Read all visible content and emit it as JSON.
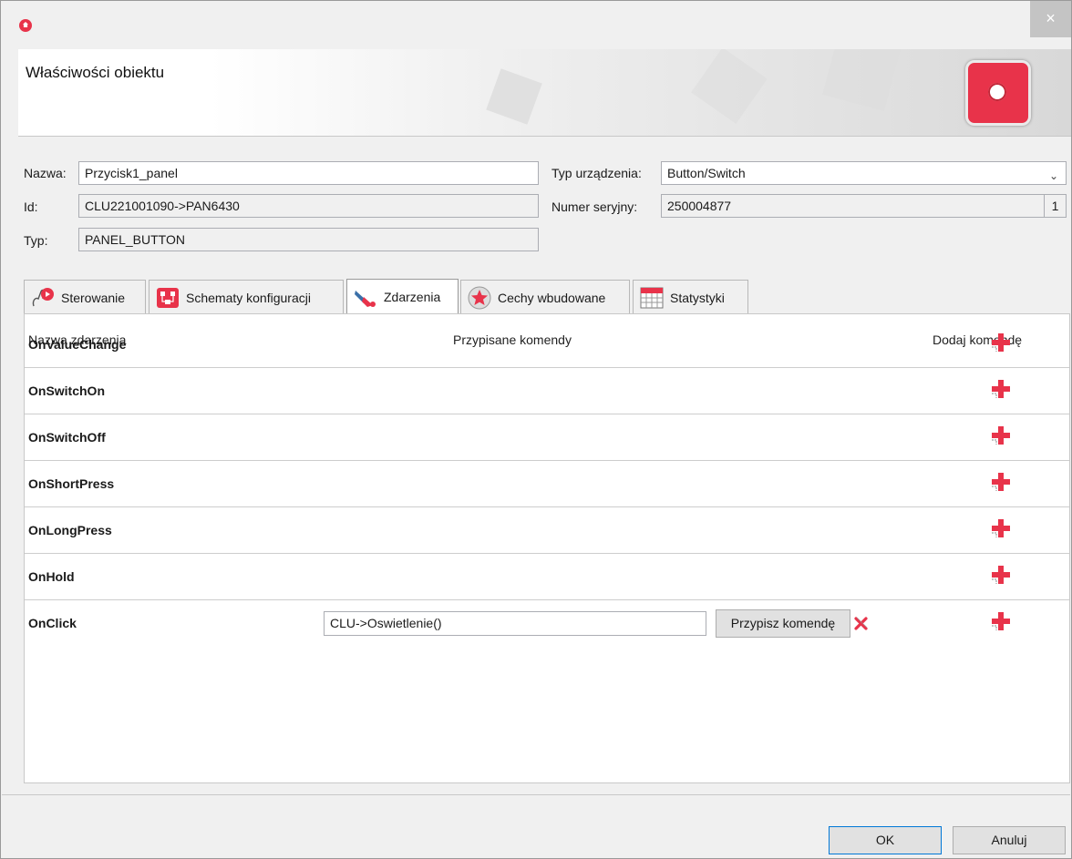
{
  "window": {
    "close_label": "×"
  },
  "header": {
    "title": "Właściwości obiektu"
  },
  "properties": {
    "name_label": "Nazwa:",
    "name_value": "Przycisk1_panel",
    "id_label": "Id:",
    "id_value": "CLU221001090->PAN6430",
    "type_label": "Typ:",
    "type_value": "PANEL_BUTTON",
    "device_type_label": "Typ urządzenia:",
    "device_type_value": "Button/Switch",
    "serial_label": "Numer seryjny:",
    "serial_value": "250004877",
    "serial_suffix": "1"
  },
  "tabs": [
    {
      "label": "Sterowanie",
      "icon": "hand-pointer-icon"
    },
    {
      "label": "Schematy konfiguracji",
      "icon": "schema-icon"
    },
    {
      "label": "Zdarzenia",
      "icon": "events-icon"
    },
    {
      "label": "Cechy wbudowane",
      "icon": "star-icon"
    },
    {
      "label": "Statystyki",
      "icon": "calendar-grid-icon"
    }
  ],
  "active_tab": "Zdarzenia",
  "events": {
    "col_name": "Nazwa zdarzenia",
    "col_commands": "Przypisane komendy",
    "col_add": "Dodaj komendę",
    "rows": [
      {
        "name": "OnValueChange"
      },
      {
        "name": "OnSwitchOn"
      },
      {
        "name": "OnSwitchOff"
      },
      {
        "name": "OnShortPress"
      },
      {
        "name": "OnLongPress"
      },
      {
        "name": "OnHold"
      },
      {
        "name": "OnClick",
        "command": "CLU->Oswietlenie()",
        "assign_label": "Przypisz komendę"
      }
    ]
  },
  "footer": {
    "ok_label": "OK",
    "cancel_label": "Anuluj"
  },
  "colors": {
    "accent": "#e8334a",
    "focus": "#0078d7"
  }
}
